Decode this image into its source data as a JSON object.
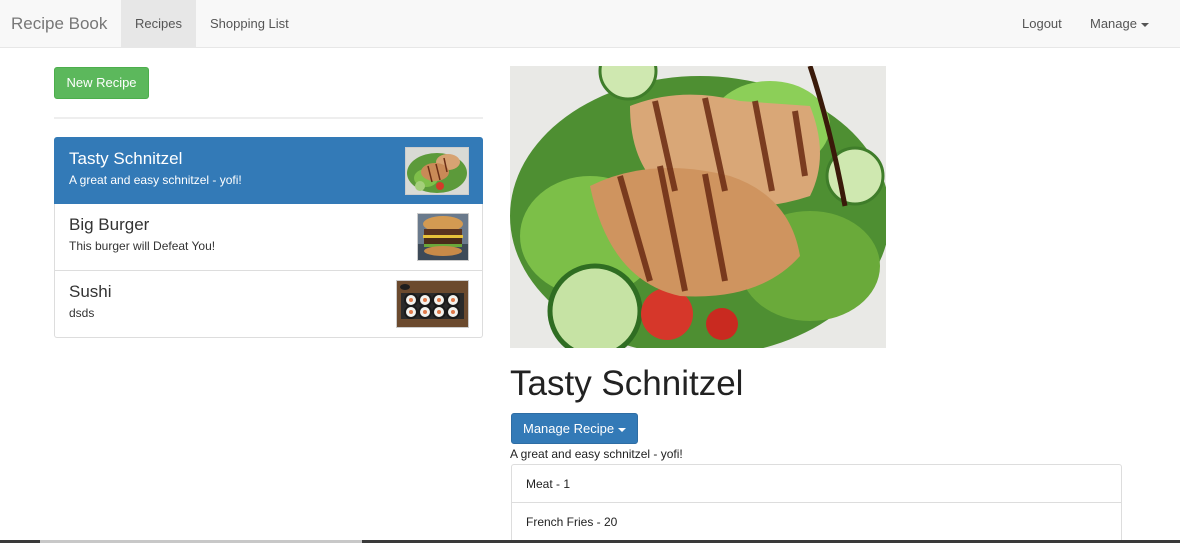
{
  "navbar": {
    "brand": "Recipe Book",
    "links": [
      {
        "label": "Recipes",
        "active": true
      },
      {
        "label": "Shopping List",
        "active": false
      }
    ],
    "logout_label": "Logout",
    "manage_label": "Manage"
  },
  "sidebar": {
    "new_recipe_label": "New Recipe",
    "recipes": [
      {
        "name": "Tasty Schnitzel",
        "description": "A great and easy schnitzel - yofi!",
        "active": true,
        "image_icon": "schnitzel-salad"
      },
      {
        "name": "Big Burger",
        "description": "This burger will Defeat You!",
        "active": false,
        "image_icon": "burger"
      },
      {
        "name": "Sushi",
        "description": "dsds",
        "active": false,
        "image_icon": "sushi-rolls"
      }
    ]
  },
  "detail": {
    "image_icon": "schnitzel-salad",
    "name": "Tasty Schnitzel",
    "manage_label": "Manage Recipe",
    "description": "A great and easy schnitzel - yofi!",
    "ingredients": [
      {
        "label": "Meat - 1"
      },
      {
        "label": "French Fries - 20"
      }
    ]
  },
  "colors": {
    "primary": "#337ab7",
    "success": "#5cb85c",
    "navbar_bg": "#f8f8f8"
  }
}
